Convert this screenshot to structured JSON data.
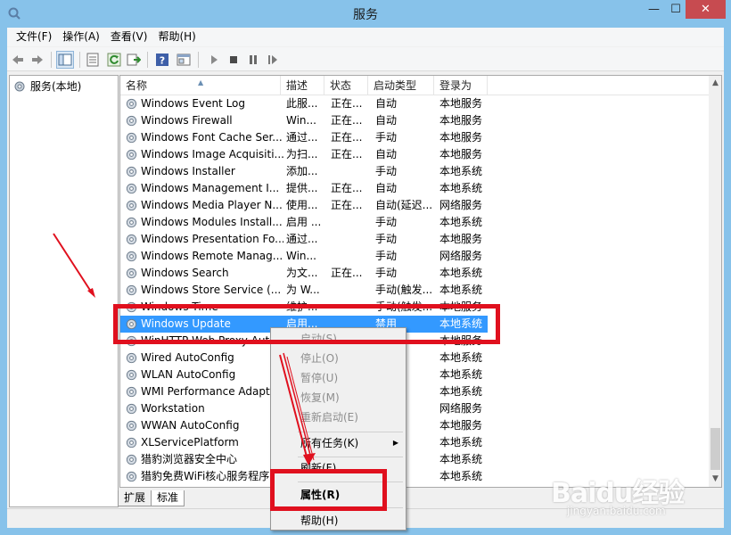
{
  "window": {
    "title": "服务"
  },
  "menubar": [
    "文件(F)",
    "操作(A)",
    "查看(V)",
    "帮助(H)"
  ],
  "tree": {
    "root": "服务(本地)"
  },
  "columns": [
    "名称",
    "描述",
    "状态",
    "启动类型",
    "登录为"
  ],
  "services": [
    {
      "name": "Windows Event Log",
      "desc": "此服...",
      "status": "正在...",
      "startup": "自动",
      "logon": "本地服务"
    },
    {
      "name": "Windows Firewall",
      "desc": "Win...",
      "status": "正在...",
      "startup": "自动",
      "logon": "本地服务"
    },
    {
      "name": "Windows Font Cache Ser...",
      "desc": "通过...",
      "status": "正在...",
      "startup": "手动",
      "logon": "本地服务"
    },
    {
      "name": "Windows Image Acquisiti...",
      "desc": "为扫...",
      "status": "正在...",
      "startup": "自动",
      "logon": "本地服务"
    },
    {
      "name": "Windows Installer",
      "desc": "添加...",
      "status": "",
      "startup": "手动",
      "logon": "本地系统"
    },
    {
      "name": "Windows Management I...",
      "desc": "提供...",
      "status": "正在...",
      "startup": "自动",
      "logon": "本地系统"
    },
    {
      "name": "Windows Media Player N...",
      "desc": "使用...",
      "status": "正在...",
      "startup": "自动(延迟...",
      "logon": "网络服务"
    },
    {
      "name": "Windows Modules Install...",
      "desc": "启用 ...",
      "status": "",
      "startup": "手动",
      "logon": "本地系统"
    },
    {
      "name": "Windows Presentation Fo...",
      "desc": "通过...",
      "status": "",
      "startup": "手动",
      "logon": "本地服务"
    },
    {
      "name": "Windows Remote Manag...",
      "desc": "Win...",
      "status": "",
      "startup": "手动",
      "logon": "网络服务"
    },
    {
      "name": "Windows Search",
      "desc": "为文...",
      "status": "正在...",
      "startup": "手动",
      "logon": "本地系统"
    },
    {
      "name": "Windows Store Service (...",
      "desc": "为 W...",
      "status": "",
      "startup": "手动(触发...",
      "logon": "本地系统"
    },
    {
      "name": "Windows Time",
      "desc": "维护...",
      "status": "",
      "startup": "手动(触发...",
      "logon": "本地服务"
    },
    {
      "name": "Windows Update",
      "desc": "启用...",
      "status": "",
      "startup": "禁用",
      "logon": "本地系统",
      "selected": true
    },
    {
      "name": "WinHTTP Web Proxy Aut...",
      "desc": "",
      "status": "",
      "startup": "",
      "logon": "本地服务"
    },
    {
      "name": "Wired AutoConfig",
      "desc": "",
      "status": "",
      "startup": "",
      "logon": "本地系统"
    },
    {
      "name": "WLAN AutoConfig",
      "desc": "",
      "status": "",
      "startup": "",
      "logon": "本地系统"
    },
    {
      "name": "WMI Performance Adapt...",
      "desc": "",
      "status": "",
      "startup": "",
      "logon": "本地系统"
    },
    {
      "name": "Workstation",
      "desc": "",
      "status": "",
      "startup": "",
      "logon": "网络服务"
    },
    {
      "name": "WWAN AutoConfig",
      "desc": "",
      "status": "",
      "startup": "",
      "logon": "本地服务"
    },
    {
      "name": "XLServicePlatform",
      "desc": "",
      "status": "",
      "startup": "",
      "logon": "本地系统"
    },
    {
      "name": "猎豹浏览器安全中心",
      "desc": "",
      "status": "",
      "startup": "",
      "logon": "本地系统"
    },
    {
      "name": "猎豹免费WiFi核心服务程序",
      "desc": "",
      "status": "",
      "startup": "",
      "logon": "本地系统"
    }
  ],
  "tabs": [
    "扩展",
    "标准"
  ],
  "context_menu": {
    "start": "启动(S)",
    "stop": "停止(O)",
    "pause": "暂停(U)",
    "resume": "恢复(M)",
    "restart": "重新启动(E)",
    "all_tasks": "所有任务(K)",
    "refresh": "刷新(F)",
    "properties": "属性(R)",
    "help": "帮助(H)"
  },
  "watermark": {
    "logo": "Baidu经验",
    "sub": "jingyan.baidu.com"
  },
  "colors": {
    "selection": "#3399ff",
    "highlight": "#e0101e",
    "titlebar": "#87c2ea",
    "close": "#c74b50"
  }
}
